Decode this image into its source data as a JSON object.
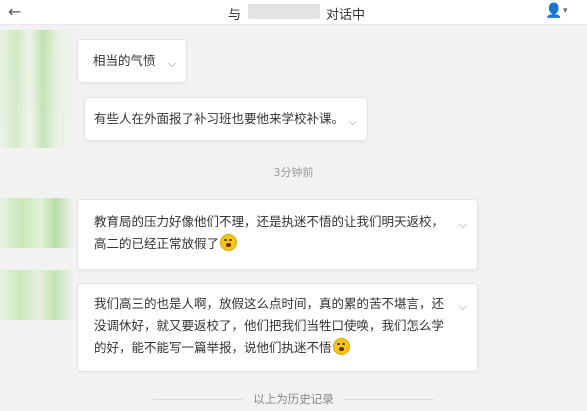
{
  "header": {
    "back_icon": "←",
    "title_prefix": "与",
    "title_suffix": "对话中",
    "user_icon": "person-plus-icon"
  },
  "messages": [
    {
      "text": "相当的气愤"
    },
    {
      "text": "有些人在外面报了补习班也要他来学校补课。"
    },
    {
      "text": "教育局的压力好像他们不理，还是执迷不悟的让我们明天返校，高二的已经正常放假了"
    },
    {
      "text": "我们高三的也是人啊，放假这么点时间，真的累的苦不堪言，还没调休好，就又要返校了，他们把我们当牲口使唤，我们怎么学的好，能不能写一篇举报，说他们执迷不悟"
    }
  ],
  "dividers": {
    "time": "3分钟前",
    "history": "以上为历史记录"
  },
  "icons": {
    "chevron": "chevron-down-icon",
    "emoji": "crying-face-icon"
  },
  "colors": {
    "background": "#f2f2f2",
    "bubble": "#ffffff",
    "muted_text": "#999999"
  }
}
